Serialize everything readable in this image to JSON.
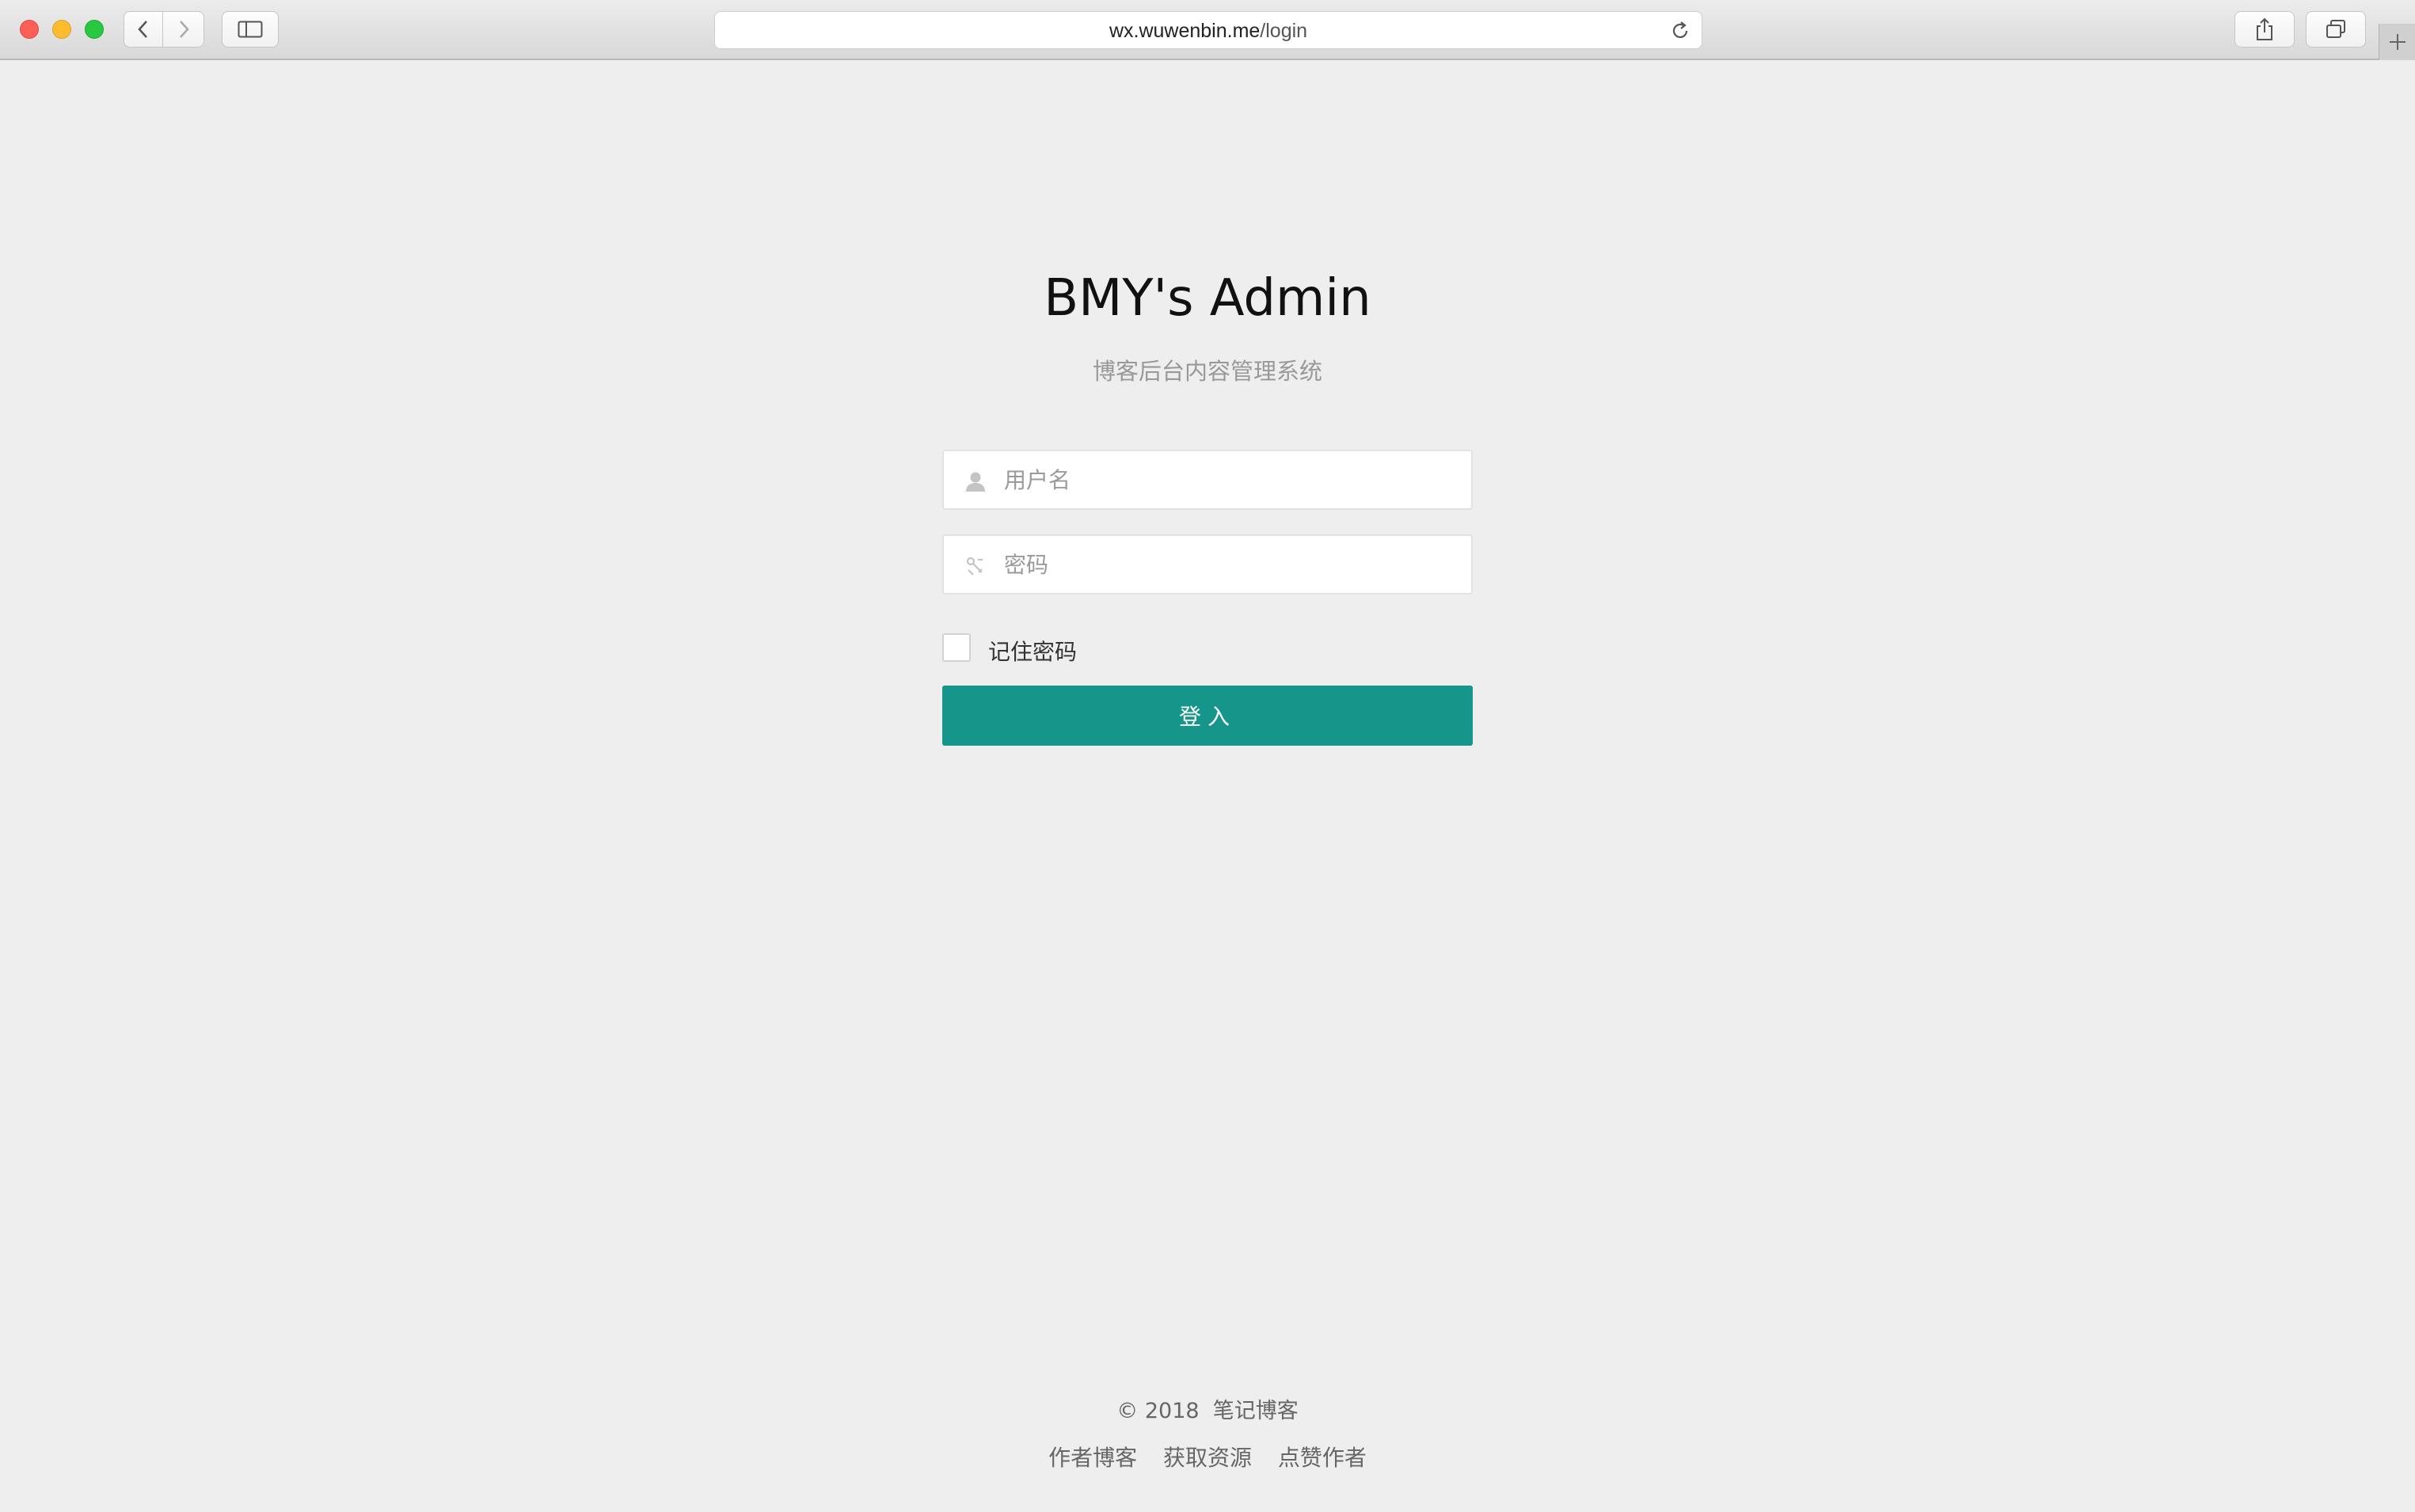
{
  "browser": {
    "url_host": "wx.wuwenbin.me",
    "url_path": "/login"
  },
  "login": {
    "title": "BMY's Admin",
    "subtitle": "博客后台内容管理系统",
    "username_placeholder": "用户名",
    "password_placeholder": "密码",
    "remember_label": "记住密码",
    "remember_checked": false,
    "submit_label": "登入"
  },
  "footer": {
    "copyright": "© 2018",
    "site_name": "笔记博客",
    "links": [
      "作者博客",
      "获取资源",
      "点赞作者"
    ]
  },
  "colors": {
    "accent": "#16968a",
    "background": "#eeeeee"
  }
}
